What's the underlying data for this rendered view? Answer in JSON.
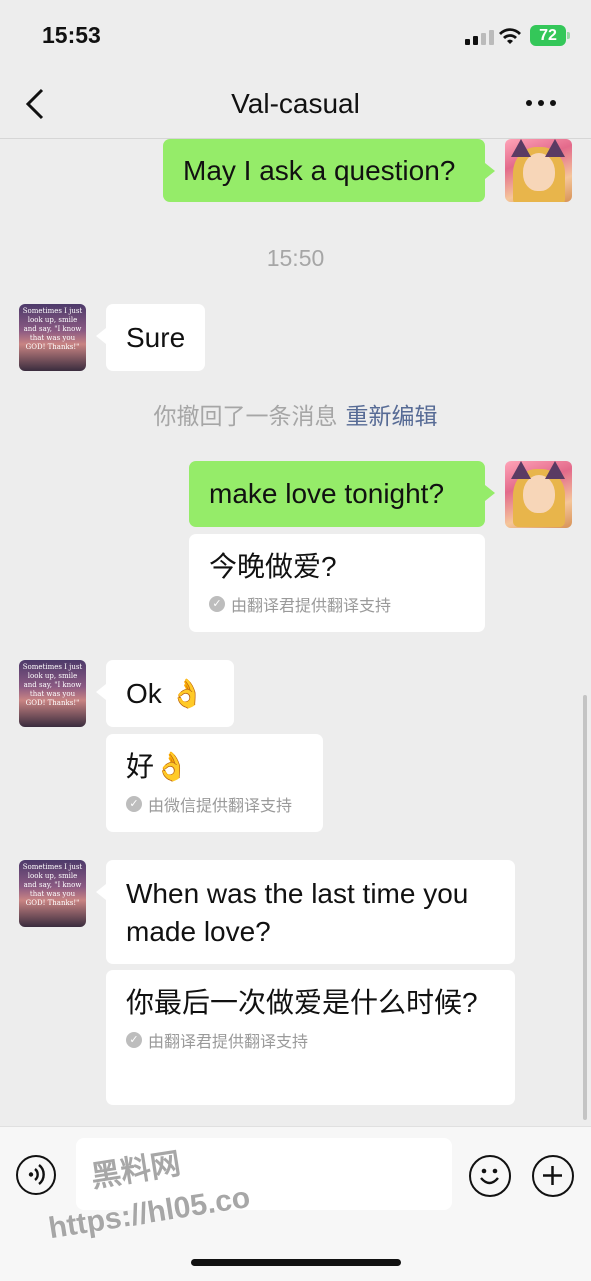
{
  "status_bar": {
    "time": "15:53",
    "battery": "72"
  },
  "header": {
    "title": "Val-casual"
  },
  "messages": {
    "m1": "May I ask a question?",
    "t1": "15:50",
    "m2": "Sure",
    "recall": "你撤回了一条消息",
    "recall_edit": "重新编辑",
    "m3": "make love tonight?",
    "m3_trans": "今晚做爱?",
    "m3_src": "由翻译君提供翻译支持",
    "m4": "Ok 👌",
    "m4_trans": "好👌",
    "m4_src": "由微信提供翻译支持",
    "m5": "When was the last time you made love?",
    "m5_trans": "你最后一次做爱是什么时候?",
    "m5_src": "由翻译君提供翻译支持"
  },
  "avatar_text": "Sometimes I just look up, smile and say, \"I know that was you GOD! Thanks!\"",
  "watermark": {
    "line1": "黑料网",
    "line2": "https://hl05.co"
  },
  "colors": {
    "sent": "#95ec69",
    "received": "#ffffff",
    "link": "#576b95",
    "battery": "#34c759"
  }
}
